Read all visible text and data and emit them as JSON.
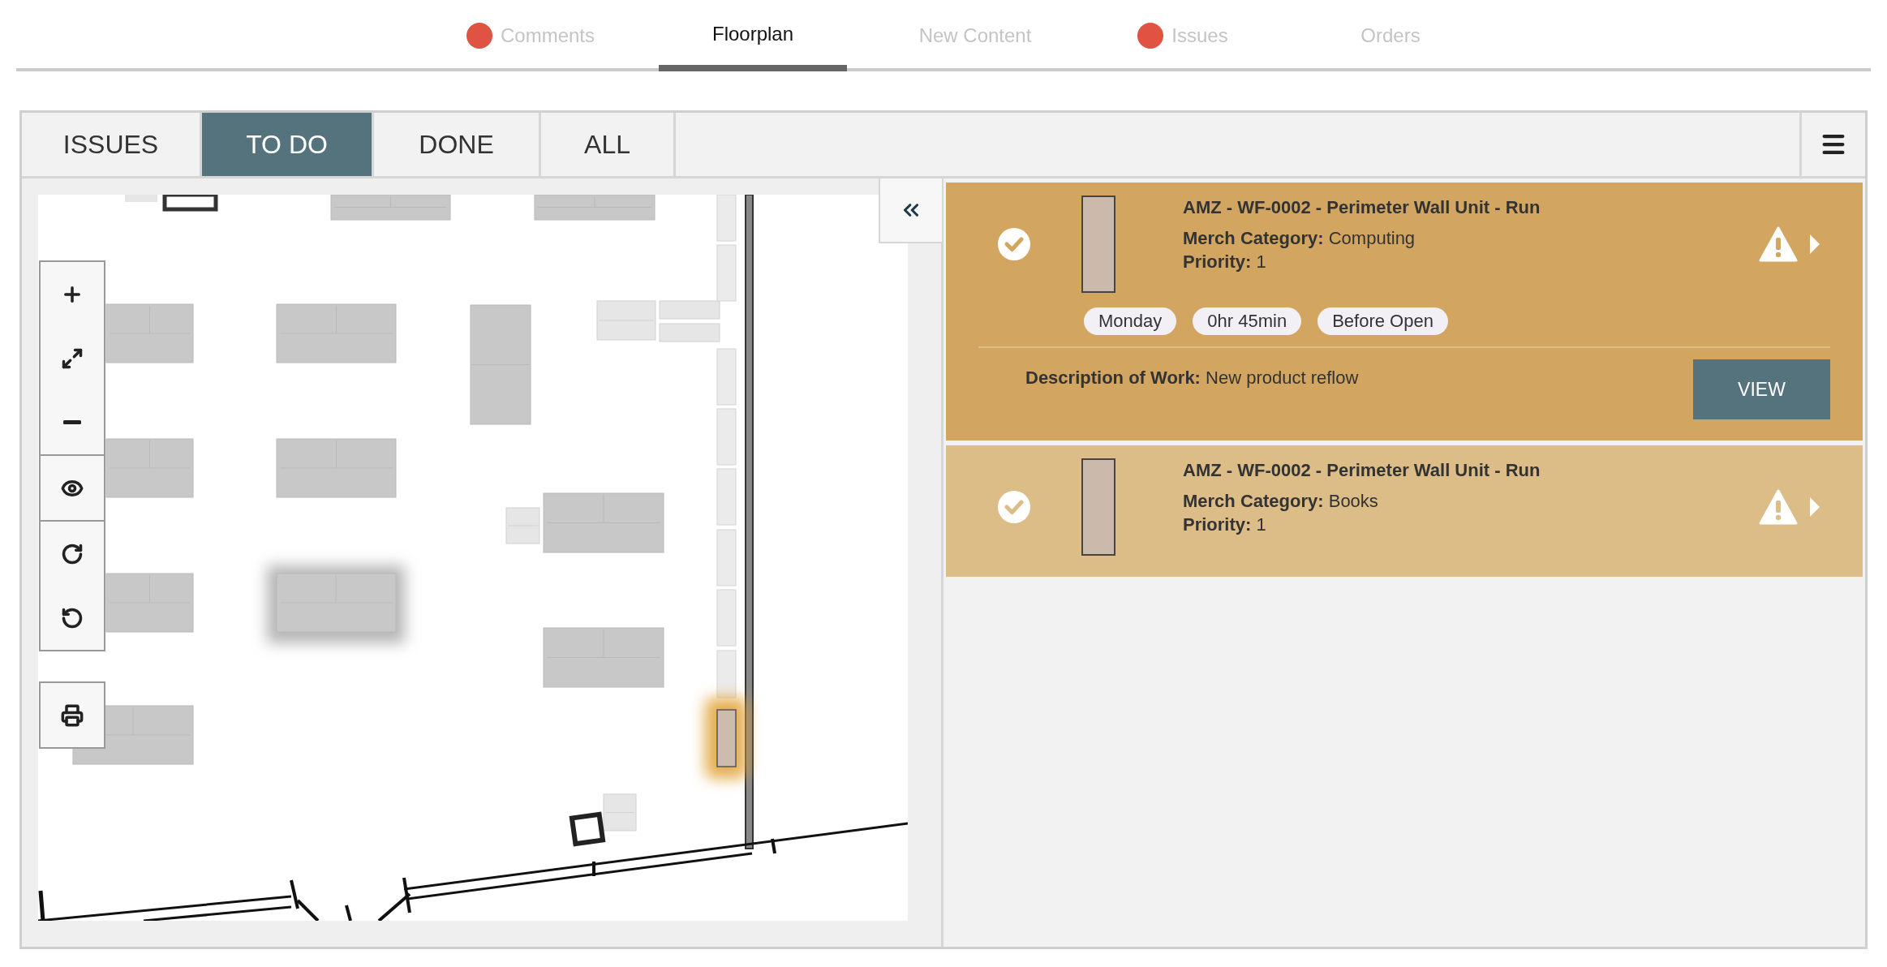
{
  "nav_tabs": [
    {
      "label": "Comments",
      "selected": false,
      "alert": true
    },
    {
      "label": "Floorplan",
      "selected": true,
      "alert": false
    },
    {
      "label": "New Content",
      "selected": false,
      "alert": false
    },
    {
      "label": "Issues",
      "selected": false,
      "alert": true
    },
    {
      "label": "Orders",
      "selected": false,
      "alert": false
    }
  ],
  "filter_tabs": [
    {
      "label": "ISSUES",
      "selected": false
    },
    {
      "label": "TO DO",
      "selected": true
    },
    {
      "label": "DONE",
      "selected": false
    },
    {
      "label": "ALL",
      "selected": false
    }
  ],
  "tasks": [
    {
      "title": "AMZ - WF-0002 - Perimeter Wall Unit - Run",
      "category": "**Merch Category:** Computing",
      "priority": "**Priority:** 1",
      "selected": true,
      "tags": [
        "Monday",
        "0hr 45min",
        "Before Open"
      ],
      "description": "**Description of Work:** New product reflow",
      "button": "VIEW"
    },
    {
      "title": "AMZ - WF-0002 - Perimeter Wall Unit - Run",
      "category": "**Merch Category:** Books",
      "priority": "**Priority:** 1",
      "selected": false
    }
  ]
}
